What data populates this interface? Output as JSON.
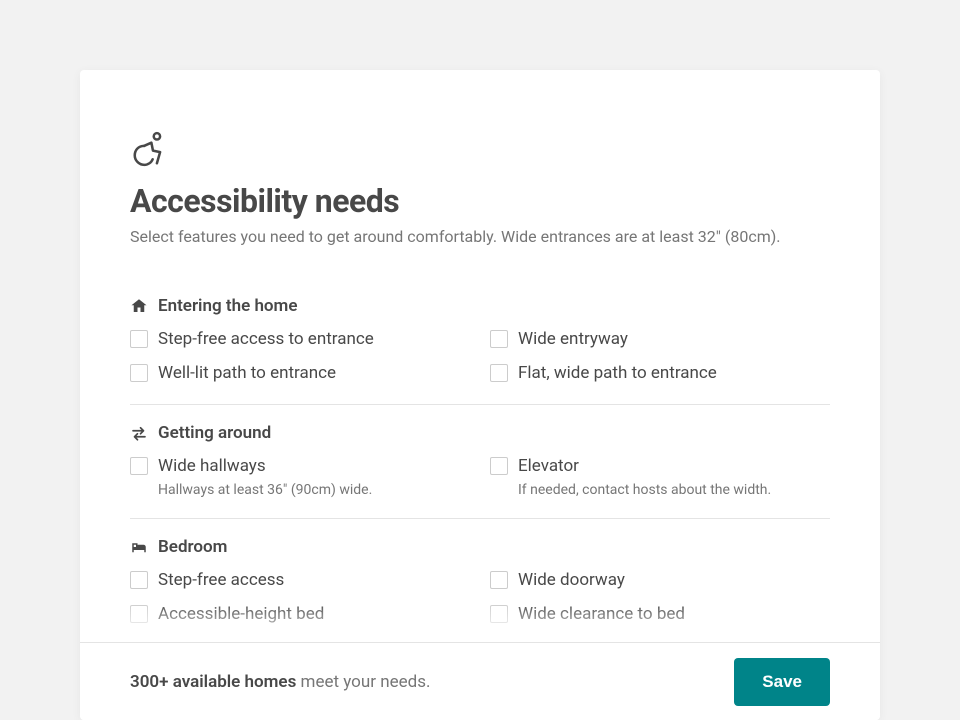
{
  "header": {
    "title": "Accessibility needs",
    "subtitle": "Select features you need to get around comfortably. Wide entrances are at least 32\" (80cm)."
  },
  "sections": {
    "entering": {
      "title": "Entering the home",
      "opt1": "Step-free access to entrance",
      "opt2": "Wide entryway",
      "opt3": "Well-lit path to entrance",
      "opt4": "Flat, wide path to entrance"
    },
    "getting_around": {
      "title": "Getting around",
      "opt1": "Wide hallways",
      "opt1_sub": "Hallways at least 36\" (90cm) wide.",
      "opt2": "Elevator",
      "opt2_sub": "If needed, contact hosts about the width."
    },
    "bedroom": {
      "title": "Bedroom",
      "opt1": "Step-free access",
      "opt2": "Wide doorway",
      "opt3": "Accessible-height bed",
      "opt4": "Wide clearance to bed"
    }
  },
  "footer": {
    "count_text": "300+ available homes",
    "rest_text": " meet your needs.",
    "save_label": "Save"
  }
}
